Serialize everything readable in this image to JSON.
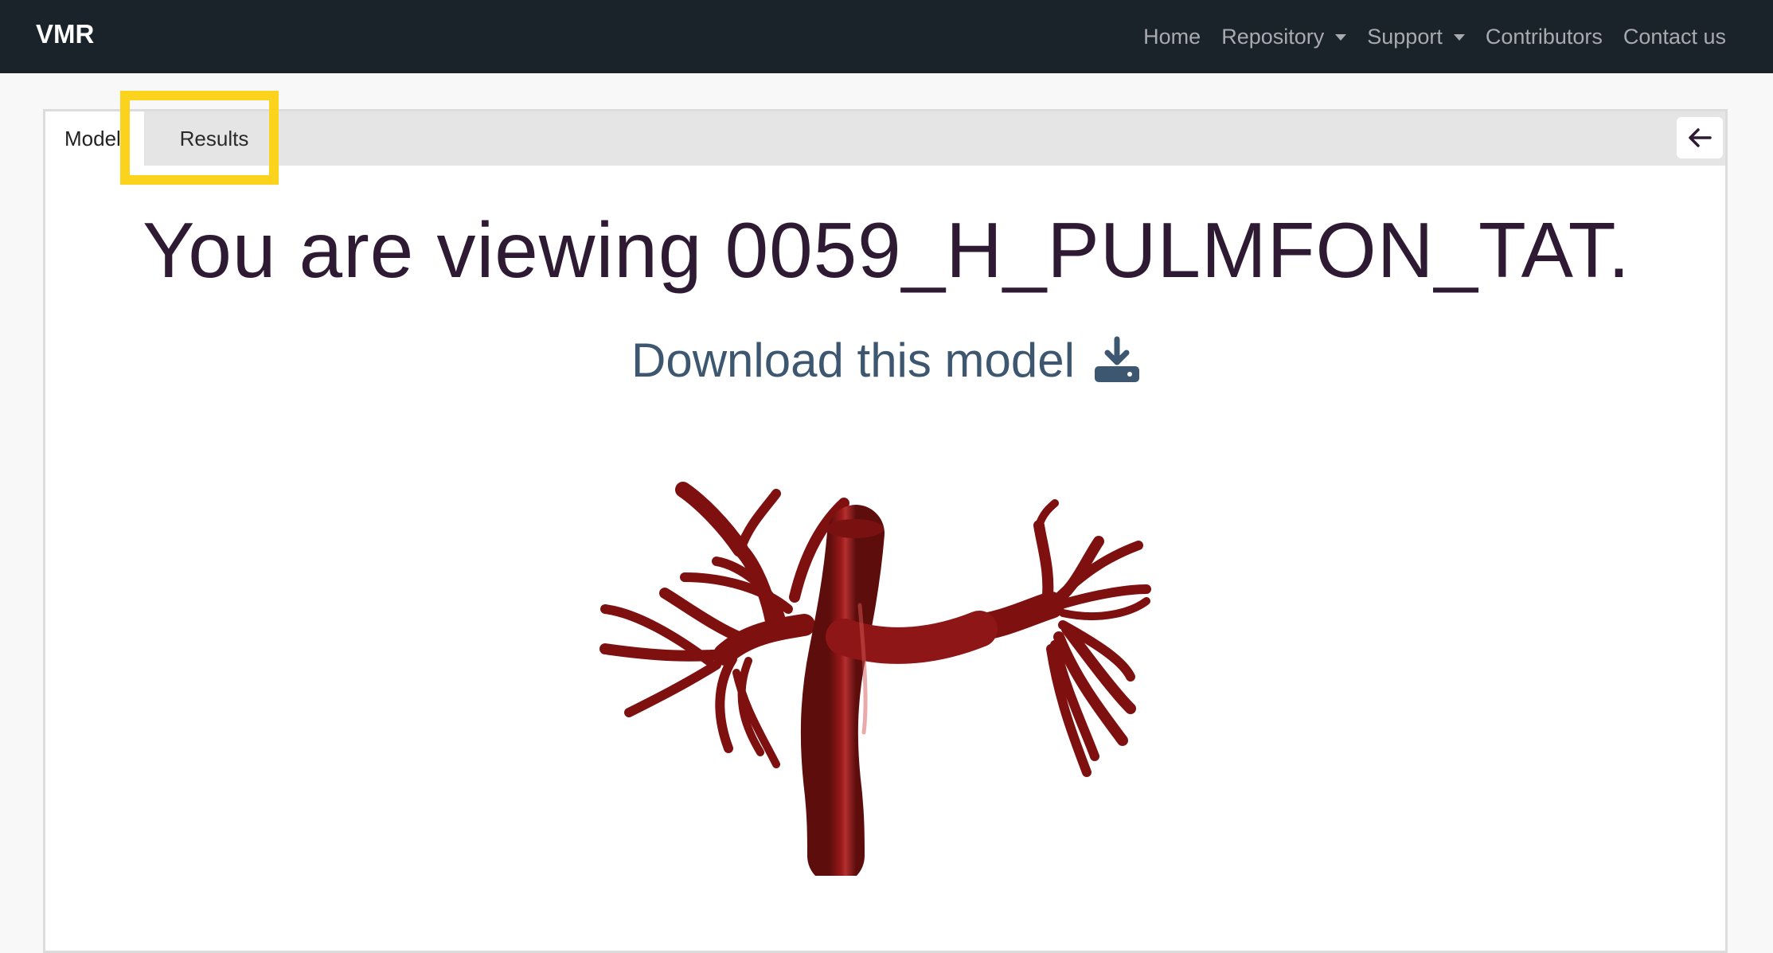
{
  "navbar": {
    "brand": "VMR",
    "links": [
      {
        "label": "Home"
      },
      {
        "label": "Repository",
        "dropdown": true
      },
      {
        "label": "Support",
        "dropdown": true
      },
      {
        "label": "Contributors"
      },
      {
        "label": "Contact us"
      }
    ]
  },
  "tabs": {
    "model_label": "Model",
    "results_label": "Results"
  },
  "back_button": {
    "icon": "arrow-left-icon"
  },
  "main": {
    "heading": "You are viewing 0059_H_PULMFON_TAT.",
    "download_label": "Download this model",
    "download_icon": "download-icon"
  },
  "colors": {
    "navbar_bg": "#1b232a",
    "highlight": "#fcd31c",
    "heading": "#2e1b33",
    "download": "#3e5770",
    "vessel": "#8b1414"
  }
}
